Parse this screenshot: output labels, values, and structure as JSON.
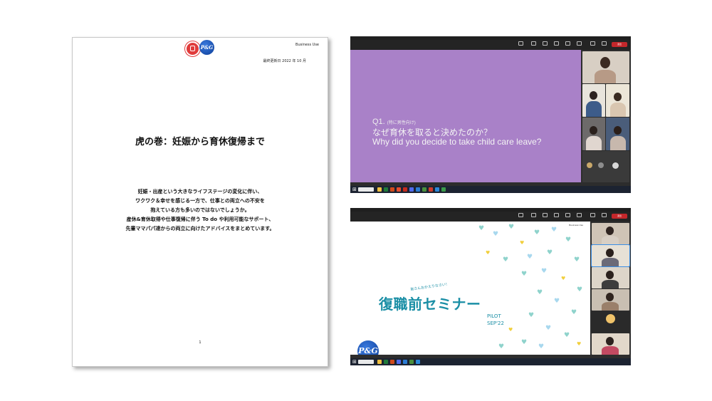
{
  "document": {
    "business_use": "Business Use",
    "updated": "最終更新日 2022 年 10 月",
    "title": "虎の巻：妊娠から育休復帰まで",
    "body_lines": [
      "妊娠・出産という大きなライフステージの変化に伴い、",
      "ワクワク＆幸せを感じる一方で、仕事との両立への不安を",
      "抱えている方も多いのではないでしょうか。",
      "産休&育休取得や仕事復帰に伴う To do や利用可能なサポート、",
      "先輩ママパパ達からの両立に向けたアドバイスをまとめています。"
    ],
    "page_number": "1",
    "logo_pg": "P&G"
  },
  "window1": {
    "slide_q": "Q1.",
    "slide_q_note": "(特に男性向け)",
    "slide_line_ja": "なぜ育休を取ると決めたのか？",
    "slide_line_en": "Why did you decide to take child care leave?",
    "leave_label": "退出",
    "colors": {
      "slide_bg": "#a981c8"
    }
  },
  "window2": {
    "subtitle": "皆さんおかえりなさい！",
    "title": "復職前セミナー",
    "pilot": "PILOT",
    "date": "SEP'22",
    "business_use": "Business Use",
    "logo": "P&G",
    "leave_label": "退出",
    "colors": {
      "accent": "#1b8fa6"
    }
  }
}
